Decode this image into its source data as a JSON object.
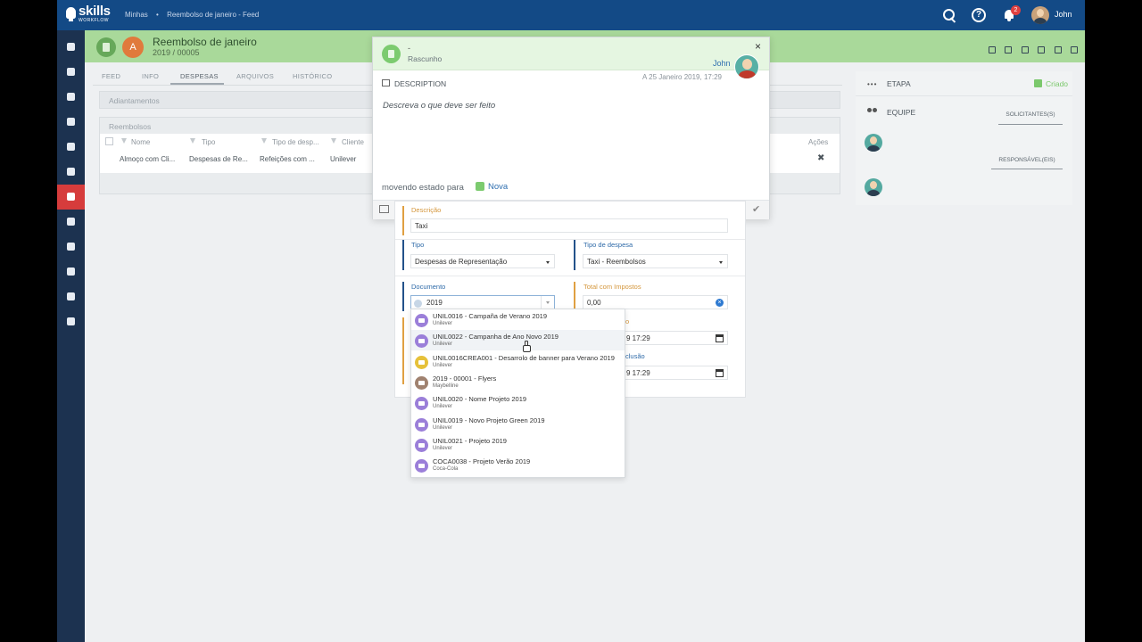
{
  "topbar": {
    "brand": "skills",
    "brand_sub": "WORKFLOW",
    "breadcrumb": [
      "Minhas",
      "•",
      "Reembolso de janeiro - Feed"
    ],
    "notifications_count": "2",
    "help_glyph": "?",
    "user_name": "John"
  },
  "sidebar": {
    "items": [
      "pin-icon",
      "team-icon",
      "briefcase-icon",
      "folder-icon",
      "list-icon",
      "calculator-icon",
      "expense-icon",
      "calendar-icon",
      "gavel-icon",
      "invoice-icon",
      "documents-icon",
      "chart-icon"
    ],
    "active_index": 6,
    "active_color": "#d63c3c"
  },
  "record": {
    "avatar_letter": "A",
    "title": "Reembolso de janeiro",
    "number": "2019 / 00005"
  },
  "tabs": [
    "FEED",
    "INFO",
    "DESPESAS",
    "ARQUIVOS",
    "HISTÓRICO"
  ],
  "active_tab": "DESPESAS",
  "adiantamentos": {
    "title": "Adiantamentos"
  },
  "reembolsos": {
    "title": "Reembolsos",
    "columns": [
      "Nome",
      "Tipo",
      "Tipo de desp...",
      "Cliente",
      "Ações"
    ],
    "rows": [
      {
        "nome": "Almoço com Cli...",
        "tipo": "Despesas de Re...",
        "tipo_despesa": "Refeições com ...",
        "cliente": "Unilever"
      }
    ],
    "delete_glyph": "✖"
  },
  "right_panel": {
    "etapa_icon": "•••",
    "etapa_label": "ETAPA",
    "stage_value": "Criado",
    "stage_color": "#7bc86c",
    "equipe_label": "EQUIPE",
    "solicitantes_tab": "SOLICITANTES(S)",
    "responsaveis_tab": "RESPONSÁVEL(EIS)"
  },
  "modal": {
    "dash": "-",
    "status": "Rascunho",
    "close_glyph": "×",
    "user": "John",
    "date": "A 25 Janeiro 2019, 17:29",
    "description_label": "DESCRIPTION",
    "description_placeholder": "Descreva o que deve ser feito",
    "moving_text": "movendo estado para",
    "next_state": "Nova",
    "confirm_glyph": "✔"
  },
  "form": {
    "descricao_label": "Descrição",
    "descricao_value": "Taxi",
    "tipo_label": "Tipo",
    "tipo_value": "Despesas de Representação",
    "tipo_despesa_label": "Tipo de despesa",
    "tipo_despesa_value": "Taxi - Reembolsos",
    "documento_label": "Documento",
    "documento_value": "2019",
    "total_label": "Total com Impostos",
    "total_value": "0,00",
    "clear_glyph": "×",
    "partial_label_1": "o",
    "date_value_1": "9 17:29",
    "partial_label_2": "clusão",
    "date_value_2": "9 17:29"
  },
  "dropdown": {
    "items": [
      {
        "title": "UNIL0016 - Campaña de Verano 2019",
        "sub": "Unilever",
        "icon": "folder-icon"
      },
      {
        "title": "UNIL0022 - Campanha de Ano Novo 2019",
        "sub": "Unilever",
        "icon": "folder-icon"
      },
      {
        "title": "UNIL0016CREA001 - Desarrolo de banner para Verano 2019",
        "sub": "Unilever",
        "icon": "list-icon"
      },
      {
        "title": "2019 - 00001 - Flyers",
        "sub": "Maybelline",
        "icon": "calculator-icon"
      },
      {
        "title": "UNIL0020 - Nome Projeto 2019",
        "sub": "Unilever",
        "icon": "folder-icon"
      },
      {
        "title": "UNIL0019 - Novo Projeto Green 2019",
        "sub": "Unilever",
        "icon": "folder-icon"
      },
      {
        "title": "UNIL0021 - Projeto 2019",
        "sub": "Unilever",
        "icon": "folder-icon"
      },
      {
        "title": "COCA0038 - Projeto Verão 2019",
        "sub": "Coca-Cola",
        "icon": "folder-icon"
      }
    ]
  }
}
